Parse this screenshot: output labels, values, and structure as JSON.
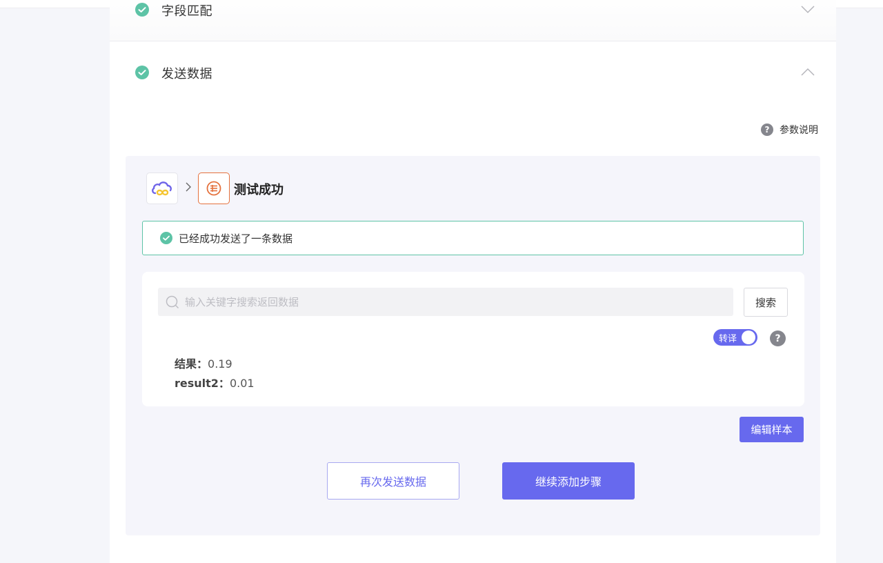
{
  "steps": {
    "prev_step": {
      "title": "字段匹配",
      "status": "completed"
    },
    "current_step": {
      "title": "发送数据",
      "status": "completed"
    }
  },
  "help_link": {
    "label": "参数说明",
    "icon": "question-circle-icon"
  },
  "test": {
    "status_text": "测试成功",
    "source_app_icon": "cloud-infinity-icon",
    "target_app_icon": "list-circle-icon"
  },
  "alert": {
    "text": "已经成功发送了一条数据",
    "color": "#5dc3a6"
  },
  "search": {
    "placeholder": "输入关键字搜索返回数据",
    "value": "",
    "button_label": "搜索"
  },
  "toggle": {
    "label": "转译",
    "on": true
  },
  "results": [
    {
      "key": "结果",
      "sep": "：",
      "value": "0.19"
    },
    {
      "key": "result2",
      "sep": "：",
      "value": "0.01"
    }
  ],
  "buttons": {
    "edit_sample": "编辑样本",
    "resend": "再次发送数据",
    "continue": "继续添加步骤"
  },
  "colors": {
    "accent": "#6769ee",
    "success": "#5dc3a6",
    "app_orange": "#e4713d"
  }
}
